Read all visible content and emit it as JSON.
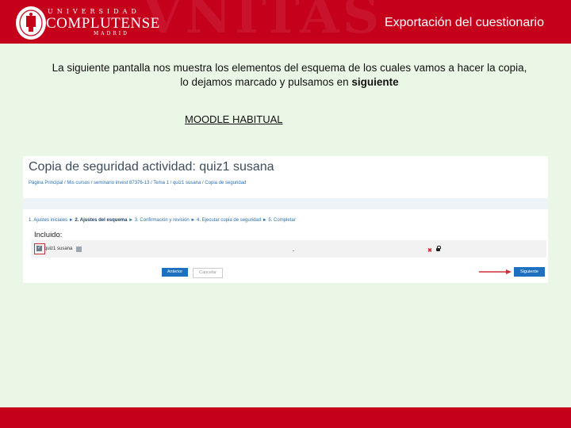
{
  "header": {
    "university_line1": "UNIVERSIDAD",
    "university_line2": "COMPLUTENSE",
    "university_line3": "MADRID",
    "background_text": "VNITAS",
    "title": "Exportación del cuestionario",
    "color": "#c5001b"
  },
  "content": {
    "intro_text": "La siguiente pantalla nos muestra los elementos del esquema de los cuales vamos a hacer la copia, lo dejamos marcado y pulsamos en",
    "intro_bold": "siguiente",
    "section_label": "MOODLE HABITUAL"
  },
  "moodle": {
    "page_title": "Copia de seguridad actividad: quiz1 susana",
    "breadcrumb": "Página Principal  /  Mis cursos  /  seminario invest 87376-13  /  Tema 1  /  quiz1 susana  /  Copia de seguridad",
    "steps_before": "1. Ajustes iniciales ► ",
    "step_current": "2. Ajustes del esquema",
    "steps_after": " ► 3. Confirmación y revisión ► 4. Ejecutar copia de seguridad ► 5. Completar",
    "included_label": "Incluido:",
    "item_label": "quiz1 susana",
    "previous_button": "Anterior",
    "cancel_button": "Cancelar",
    "next_button": "Siguiente",
    "item_checked": true
  }
}
